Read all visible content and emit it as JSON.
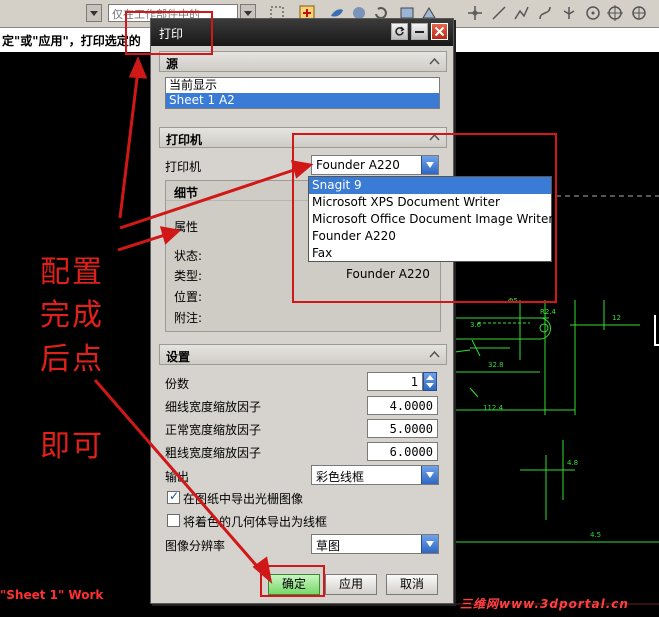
{
  "app_toolbar": {
    "layer_combo": "仅在工作部件中的",
    "cad_text": "\"Sheet 1\" Work"
  },
  "hint_text": "定\"或\"应用\"，打印选定的",
  "dialog": {
    "title": "打印",
    "source": {
      "header": "源",
      "items": [
        "当前显示",
        "Sheet 1  A2"
      ],
      "selected_index": 1
    },
    "printer": {
      "header": "打印机",
      "printer_label": "打印机",
      "printer_value": "Founder A220",
      "details_header": "细节",
      "properties_label": "属性",
      "status_label": "状态:",
      "type_label": "类型:",
      "type_value": "Founder A220",
      "location_label": "位置:",
      "comment_label": "附注:",
      "dropdown_options": [
        "Snagit 9",
        "Microsoft XPS Document Writer",
        "Microsoft Office Document Image Writer",
        "Founder A220",
        "Fax"
      ],
      "highlighted_option_index": 0
    },
    "settings": {
      "header": "设置",
      "copies_label": "份数",
      "copies_value": "1",
      "thin_width_label": "细线宽度缩放因子",
      "thin_width_value": "4.0000",
      "normal_width_label": "正常宽度缩放因子",
      "normal_width_value": "5.0000",
      "thick_width_label": "粗线宽度缩放因子",
      "thick_width_value": "6.0000",
      "output_label": "输出",
      "output_value": "彩色线框",
      "raster_label": "在图纸中导出光栅图像",
      "raster_checked": true,
      "wireframe_label": "将着色的几何体导出为线框",
      "wireframe_checked": false,
      "resolution_label": "图像分辨率",
      "resolution_value": "草图"
    },
    "buttons": {
      "ok": "确定",
      "apply": "应用",
      "cancel": "取消"
    }
  },
  "annotation": {
    "line1": "配置",
    "line2": "完成",
    "line3": "后点",
    "line4": "即可"
  },
  "watermark": "三维网www.3dportal.cn",
  "colors": {
    "annotation_red": "#e0201a",
    "selection_blue": "#3a7bd5",
    "ok_green": "#78d86a"
  }
}
